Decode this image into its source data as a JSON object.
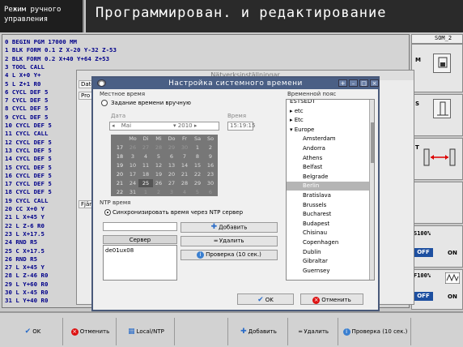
{
  "header": {
    "mode_line1": "Режим ручного",
    "mode_line2": "управления",
    "title": "Программирован. и редактирование"
  },
  "program": [
    "0  BEGIN PGM 17000 MM",
    "1  BLK FORM 0.1 Z  X-20  Y-32  Z-53",
    "2  BLK FORM 0.2 X+40 Y+64 Z+53",
    "3  TOOL CALL",
    "4  L  X+0  Y+",
    "5  L  Z+1 R0",
    "6  CYCL DEF 5",
    "7  CYCL DEF 5",
    "8  CYCL DEF 5",
    "9  CYCL DEF 5",
    "10 CYCL DEF 5",
    "11 CYCL CALL",
    "12 CYCL DEF 5",
    "13 CYCL DEF 5",
    "14 CYCL DEF 5",
    "15 CYCL DEF 5",
    "16 CYCL DEF 5",
    "17 CYCL DEF 5",
    "18 CYCL DEF 5",
    "19 CYCL CALL",
    "20 CC  X+0  Y",
    "21 L  X+45  Y",
    "22 L  Z-6 R0",
    "23 L  X+17.5",
    "24 RND R5",
    "25 C  X+17.5",
    "26 RND R5",
    "27 L  X+45  Y",
    "28 L  Z-46 R0",
    "29 L  Y+60 R0",
    "30 L  X-45 R0",
    "31 L  Y+40 R0"
  ],
  "right_panel": {
    "som": "SOM_2",
    "m": "M",
    "s": "S",
    "t": "T",
    "s_feed": "S100%",
    "f_feed": "F100%",
    "off": "OFF",
    "on": "ON"
  },
  "bg_dialog": {
    "title": "Nätverksinställningar",
    "tab_date": "Date",
    "tab_pro": "Pro",
    "tab_fjar": "Fjär"
  },
  "dialog": {
    "title": "Настройка системного времени",
    "local_time_label": "Местное время",
    "manual_radio": "Задание времени вручную",
    "date_label": "Дата",
    "time_label": "Время",
    "month": "Mai",
    "year": "2010",
    "time_value": "15:19:15",
    "weekdays": [
      "Mo",
      "Di",
      "Mi",
      "Do",
      "Fr",
      "Sa",
      "So"
    ],
    "weeks": [
      {
        "wk": "17",
        "days": [
          "26",
          "27",
          "28",
          "29",
          "30",
          "1",
          "2"
        ]
      },
      {
        "wk": "18",
        "days": [
          "3",
          "4",
          "5",
          "6",
          "7",
          "8",
          "9"
        ]
      },
      {
        "wk": "19",
        "days": [
          "10",
          "11",
          "12",
          "13",
          "14",
          "15",
          "16"
        ]
      },
      {
        "wk": "20",
        "days": [
          "17",
          "18",
          "19",
          "20",
          "21",
          "22",
          "23"
        ]
      },
      {
        "wk": "21",
        "days": [
          "24",
          "25",
          "26",
          "27",
          "28",
          "29",
          "30"
        ]
      },
      {
        "wk": "22",
        "days": [
          "31",
          "1",
          "2",
          "3",
          "4",
          "5",
          "6"
        ]
      }
    ],
    "ntp_label": "NTP время",
    "ntp_radio": "Синхронизировать время через NTP сервер",
    "add_button": "Добавить",
    "delete_button": "Удалить",
    "check_button": "Проверка (10 сек.)",
    "server_header": "Сервер",
    "servers": [
      "de01ux08"
    ],
    "timezone_label": "Временной пояс",
    "timezones": [
      {
        "name": "ESTSEDT",
        "kind": "tree"
      },
      {
        "name": "etc",
        "kind": "tree-c"
      },
      {
        "name": "Etc",
        "kind": "tree-c"
      },
      {
        "name": "Europe",
        "kind": "tree-o"
      },
      {
        "name": "Amsterdam",
        "kind": "item"
      },
      {
        "name": "Andorra",
        "kind": "item"
      },
      {
        "name": "Athens",
        "kind": "item"
      },
      {
        "name": "Belfast",
        "kind": "item"
      },
      {
        "name": "Belgrade",
        "kind": "item"
      },
      {
        "name": "Berlin",
        "kind": "sel"
      },
      {
        "name": "Bratislava",
        "kind": "item"
      },
      {
        "name": "Brussels",
        "kind": "item"
      },
      {
        "name": "Bucharest",
        "kind": "item"
      },
      {
        "name": "Budapest",
        "kind": "item"
      },
      {
        "name": "Chisinau",
        "kind": "item"
      },
      {
        "name": "Copenhagen",
        "kind": "item"
      },
      {
        "name": "Dublin",
        "kind": "item"
      },
      {
        "name": "Gibraltar",
        "kind": "item"
      },
      {
        "name": "Guernsey",
        "kind": "item"
      }
    ],
    "ok_button": "OK",
    "cancel_button": "Отменить"
  },
  "softkeys": {
    "ok": "OK",
    "cancel": "Отменить",
    "local_ntp": "Local/NTP",
    "add": "Добавить",
    "delete": "Удалить",
    "check": "Проверка (10 сек.)"
  }
}
